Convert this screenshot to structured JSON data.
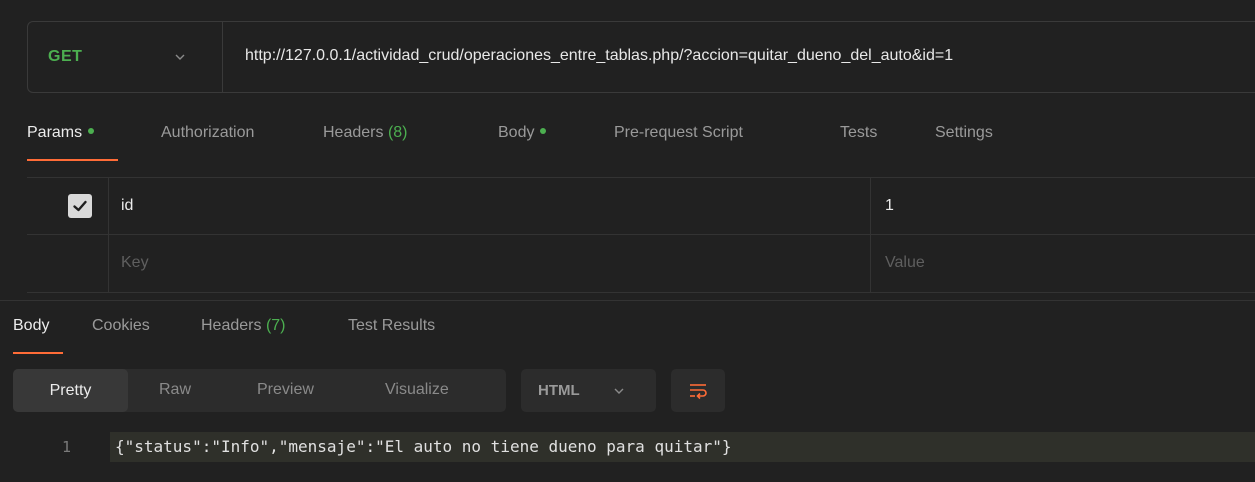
{
  "request": {
    "method": "GET",
    "url": "http://127.0.0.1/actividad_crud/operaciones_entre_tablas.php/?accion=quitar_dueno_del_auto&id=1"
  },
  "request_tabs": {
    "params": "Params",
    "authorization": "Authorization",
    "headers": "Headers",
    "headers_count": "(8)",
    "body": "Body",
    "pre_request": "Pre-request Script",
    "tests": "Tests",
    "settings": "Settings"
  },
  "params": {
    "rows": [
      {
        "checked": true,
        "key": "id",
        "value": "1"
      }
    ],
    "placeholder_key": "Key",
    "placeholder_value": "Value"
  },
  "response_tabs": {
    "body": "Body",
    "cookies": "Cookies",
    "headers": "Headers",
    "headers_count": "(7)",
    "test_results": "Test Results"
  },
  "format": {
    "pretty": "Pretty",
    "raw": "Raw",
    "preview": "Preview",
    "visualize": "Visualize",
    "language": "HTML"
  },
  "response_body": {
    "line_number": "1",
    "content": "{\"status\":\"Info\",\"mensaje\":\"El auto no tiene dueno para quitar\"}"
  },
  "colors": {
    "method": "#4caf50",
    "accent": "#ff6c37",
    "indicator": "#4caf50"
  }
}
